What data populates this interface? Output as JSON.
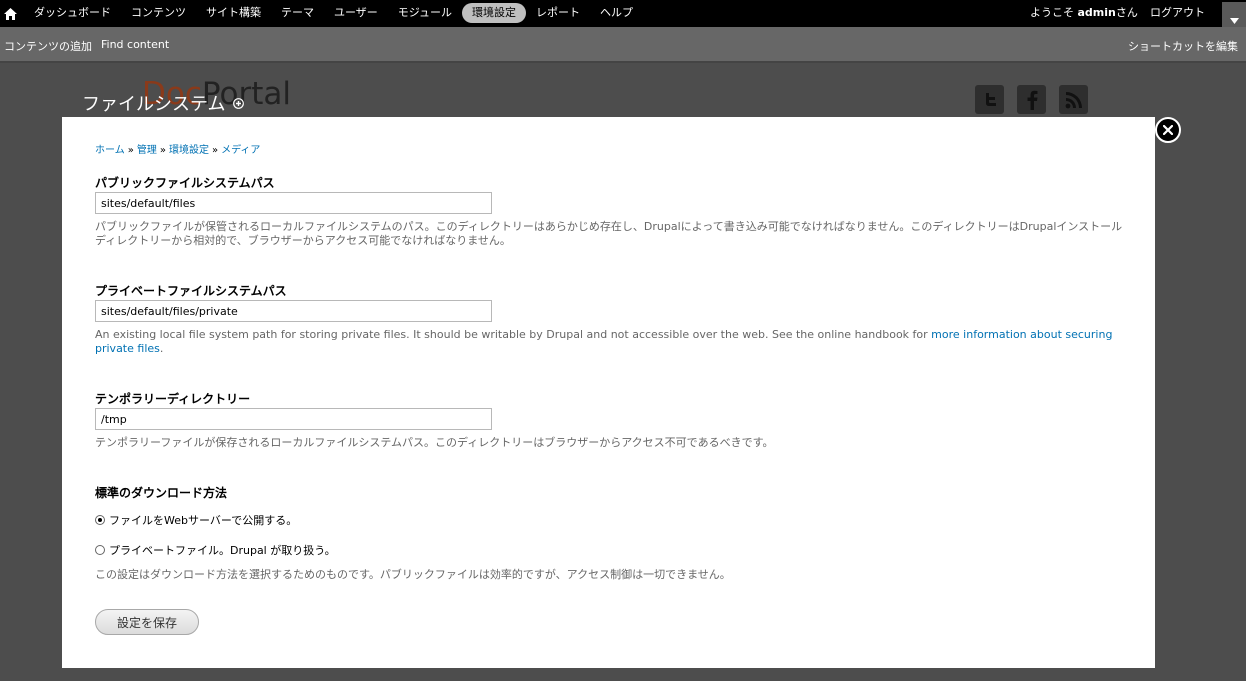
{
  "toolbar": {
    "menu": [
      {
        "label": "ダッシュボード",
        "active": false
      },
      {
        "label": "コンテンツ",
        "active": false
      },
      {
        "label": "サイト構築",
        "active": false
      },
      {
        "label": "テーマ",
        "active": false
      },
      {
        "label": "ユーザー",
        "active": false
      },
      {
        "label": "モジュール",
        "active": false
      },
      {
        "label": "環境設定",
        "active": true
      },
      {
        "label": "レポート",
        "active": false
      },
      {
        "label": "ヘルプ",
        "active": false
      }
    ],
    "welcome_prefix": "ようこそ",
    "username": "admin",
    "welcome_suffix": "さん",
    "logout": "ログアウト"
  },
  "shortcuts": {
    "items": [
      "コンテンツの追加",
      "Find content"
    ],
    "edit": "ショートカットを編集"
  },
  "site": {
    "logo_prefix": "Doc",
    "logo_suffix": "Portal"
  },
  "overlay": {
    "title": "ファイルシステム"
  },
  "breadcrumb": [
    "ホーム",
    "管理",
    "環境設定",
    "メディア"
  ],
  "breadcrumb_sep": "»",
  "form": {
    "public_path": {
      "label": "パブリックファイルシステムパス",
      "value": "sites/default/files",
      "description": "パブリックファイルが保管されるローカルファイルシステムのパス。このディレクトリーはあらかじめ存在し、Drupalによって書き込み可能でなければなりません。このディレクトリーはDrupalインストールディレクトリーから相対的で、ブラウザーからアクセス可能でなければなりません。"
    },
    "private_path": {
      "label": "プライベートファイルシステムパス",
      "value": "sites/default/files/private",
      "description": "An existing local file system path for storing private files. It should be writable by Drupal and not accessible over the web. See the online handbook for ",
      "link": "more information about securing private files",
      "description_end": "."
    },
    "temp_dir": {
      "label": "テンポラリーディレクトリー",
      "value": "/tmp",
      "description": "テンポラリーファイルが保存されるローカルファイルシステムパス。このディレクトリーはブラウザーからアクセス不可であるべきです。"
    },
    "download_method": {
      "label": "標準のダウンロード方法",
      "options": [
        {
          "label": "ファイルをWebサーバーで公開する。",
          "checked": true
        },
        {
          "label": "プライベートファイル。Drupal が取り扱う。",
          "checked": false
        }
      ],
      "description": "この設定はダウンロード方法を選択するためのものです。パブリックファイルは効率的ですが、アクセス制御は一切できません。"
    },
    "submit": "設定を保存"
  },
  "colors": {
    "toolbar": "#000000",
    "shortcut_bar": "#676767",
    "link": "#0071b3",
    "active_tab": "#bfbfbf"
  }
}
